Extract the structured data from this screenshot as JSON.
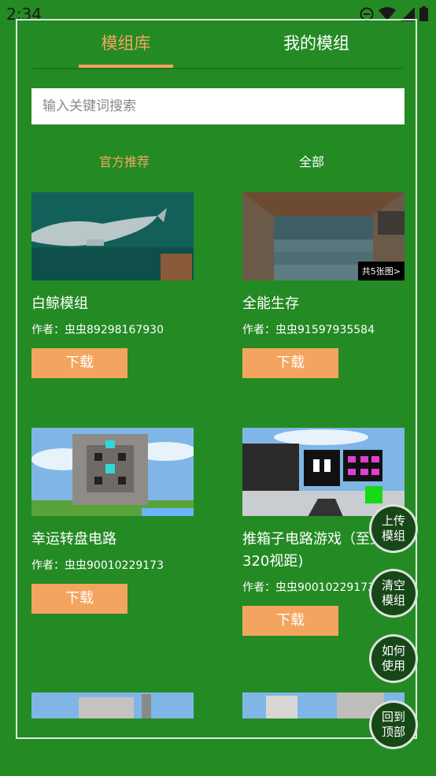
{
  "status_bar": {
    "time": "2:34"
  },
  "tabs": [
    {
      "label": "模组库",
      "active": true
    },
    {
      "label": "我的模组",
      "active": false
    }
  ],
  "search": {
    "placeholder": "输入关键词搜索",
    "value": ""
  },
  "filters": [
    {
      "label": "官方推荐",
      "active": true
    },
    {
      "label": "全部",
      "active": false
    }
  ],
  "mods": [
    {
      "title": "白鲸模组",
      "author": "作者：虫虫89298167930",
      "download": "下载",
      "thumb": "whale-thumbnail"
    },
    {
      "title": "全能生存",
      "author": "作者：虫虫91597935584",
      "download": "下载",
      "thumb": "dungeon-thumbnail",
      "badge": "共5张图>"
    },
    {
      "title": "幸运转盘电路",
      "author": "作者：虫虫90010229173",
      "download": "下载",
      "thumb": "roulette-thumbnail"
    },
    {
      "title": "推箱子电路游戏（至少320视距)",
      "author": "作者：虫虫90010229173",
      "download": "下载",
      "thumb": "sokoban-thumbnail"
    }
  ],
  "fab": [
    {
      "label": "上传模组"
    },
    {
      "label": "清空模组"
    },
    {
      "label": "如何使用"
    },
    {
      "label": "回到顶部"
    }
  ],
  "colors": {
    "background": "#248a24",
    "accent": "#f3a55f",
    "fab_bg": "#174717"
  }
}
